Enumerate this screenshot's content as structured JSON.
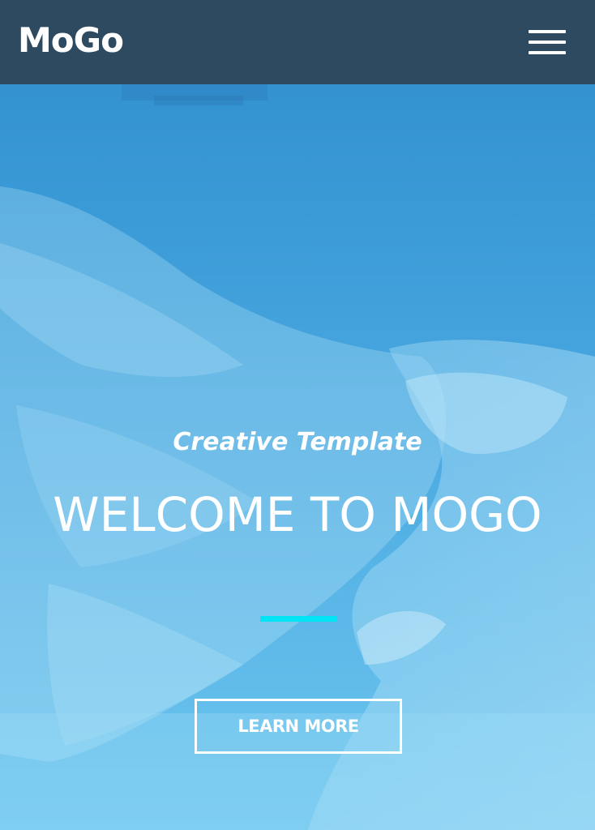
{
  "header": {
    "logo": "MoGo",
    "menu_icon": "hamburger-menu-icon"
  },
  "hero": {
    "subtitle": "Creative Template",
    "title": "WELCOME TO MOGO",
    "cta_label": "LEARN MORE",
    "background_image": "eagle-photo"
  },
  "colors": {
    "header_bg": "#2d4a61",
    "hero_overlay": "#3a9ad6",
    "accent": "#00e5f5",
    "text": "#ffffff"
  }
}
